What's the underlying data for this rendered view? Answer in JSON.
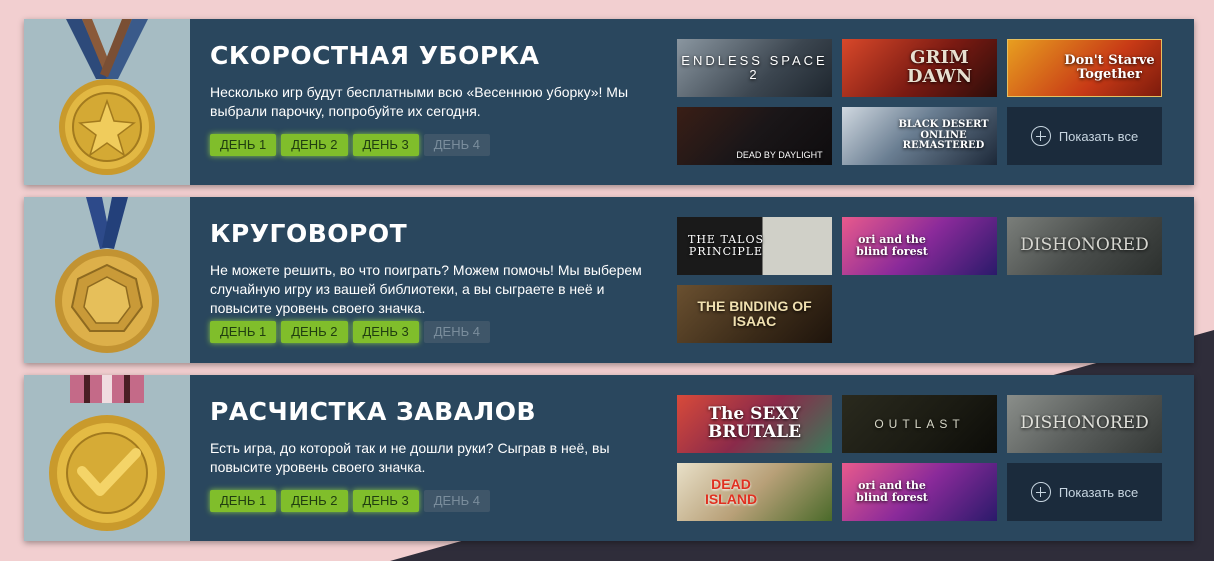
{
  "panels": [
    {
      "title": "СКОРОСТНАЯ УБОРКА",
      "description": "Несколько игр будут бесплатными всю «Весеннюю уборку»! Мы выбрали парочку, попробуйте их сегодня.",
      "days": [
        "ДЕНЬ 1",
        "ДЕНЬ 2",
        "ДЕНЬ 3",
        "ДЕНЬ 4"
      ],
      "games": [
        "ENDLESS SPACE 2",
        "GRIM DAWN",
        "Don't Starve Together",
        "DEAD BY DAYLIGHT",
        "BLACK DESERT ONLINE REMASTERED"
      ],
      "show_all": "Показать все"
    },
    {
      "title": "КРУГОВОРОТ",
      "description": "Не можете решить, во что поиграть? Можем помочь! Мы выберем случайную игру из вашей библиотеки, а вы сыграете в неё и повысите уровень своего значка.",
      "days": [
        "ДЕНЬ 1",
        "ДЕНЬ 2",
        "ДЕНЬ 3",
        "ДЕНЬ 4"
      ],
      "games": [
        "THE TALOS PRINCIPLE",
        "ori and the blind forest",
        "DISHONORED",
        "THE BINDING OF ISAAC"
      ]
    },
    {
      "title": "РАСЧИСТКА ЗАВАЛОВ",
      "description": "Есть игра, до которой так и не дошли руки? Сыграв в неё, вы повысите уровень своего значка.",
      "days": [
        "ДЕНЬ 1",
        "ДЕНЬ 2",
        "ДЕНЬ 3",
        "ДЕНЬ 4"
      ],
      "games": [
        "The SEXY BRUTALE",
        "OUTLAST",
        "DISHONORED",
        "DEAD ISLAND",
        "ori and the blind forest"
      ],
      "show_all": "Показать все"
    }
  ],
  "day_state": {
    "active_days": 3,
    "total_days": 4
  },
  "colors": {
    "panel_bg": "#2a475e",
    "active_day": "#80be2b",
    "inactive_day": "#3f5669",
    "page_bg": "#f2cfd0",
    "medal_bg": "#a6bcc3"
  },
  "icons": [
    "medal-icon",
    "plus-icon"
  ]
}
